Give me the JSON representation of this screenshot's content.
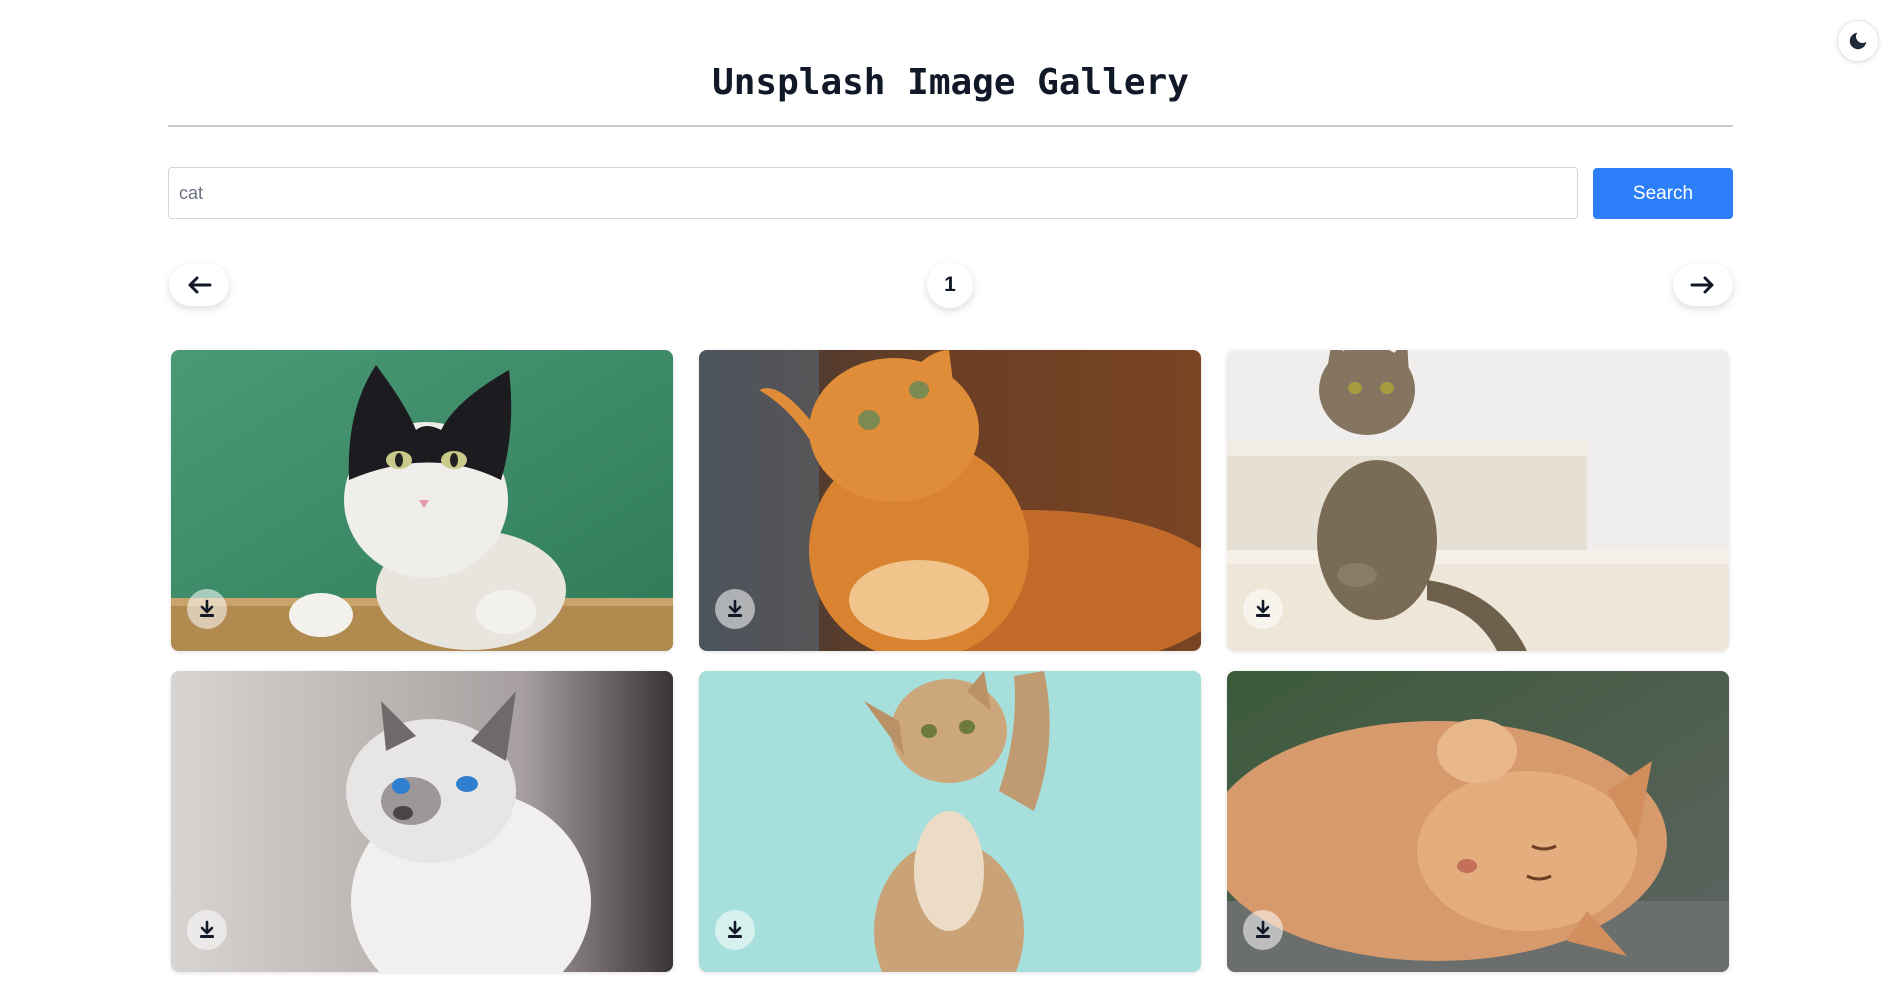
{
  "header": {
    "title": "Unsplash Image Gallery",
    "theme_toggle_icon": "moon-icon"
  },
  "search": {
    "value": "cat",
    "button_label": "Search"
  },
  "pagination": {
    "prev_icon": "arrow-left-icon",
    "current_page": "1",
    "next_icon": "arrow-right-icon"
  },
  "gallery": {
    "images": [
      {
        "subject": "black-and-white cat on green background",
        "download_icon": "download-icon"
      },
      {
        "subject": "orange tabby cat looking up",
        "download_icon": "download-icon"
      },
      {
        "subject": "brown tabby cat sitting on stairs",
        "download_icon": "download-icon"
      },
      {
        "subject": "siamese cat with blue eyes",
        "download_icon": "download-icon"
      },
      {
        "subject": "kitten reaching up on teal background",
        "download_icon": "download-icon"
      },
      {
        "subject": "orange cat lying on its back",
        "download_icon": "download-icon"
      }
    ]
  },
  "colors": {
    "accent": "#2d7ff9",
    "title": "#111827",
    "divider": "#c8ccd2"
  }
}
